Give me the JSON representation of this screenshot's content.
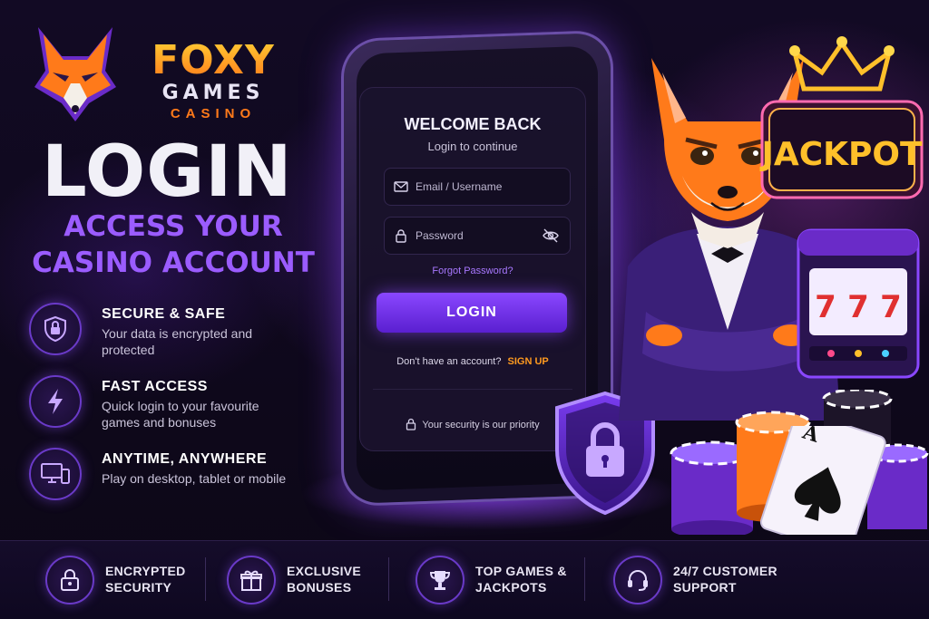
{
  "brand": {
    "name": "FOXY",
    "games": "GAMES",
    "casino": "CASINO"
  },
  "hero": {
    "title": "LOGIN",
    "subtitle_line1": "ACCESS YOUR",
    "subtitle_line2": "CASINO ACCOUNT"
  },
  "features": [
    {
      "icon": "shield-lock-icon",
      "title": "SECURE & SAFE",
      "desc": "Your data is encrypted and protected"
    },
    {
      "icon": "lightning-icon",
      "title": "FAST ACCESS",
      "desc": "Quick login to your favourite games and bonuses"
    },
    {
      "icon": "devices-icon",
      "title": "ANYTIME, ANYWHERE",
      "desc": "Play on desktop, tablet or mobile"
    }
  ],
  "login_form": {
    "heading": "WELCOME BACK",
    "subheading": "Login to continue",
    "email_placeholder": "Email / Username",
    "password_placeholder": "Password",
    "forgot_link": "Forgot Password?",
    "login_button": "LOGIN",
    "no_account_text": "Don't have an account?",
    "signup_link": "SIGN UP",
    "security_note": "Your security is our priority"
  },
  "art": {
    "jackpot_text": "JACKPOT",
    "slot_reels": [
      "7",
      "7",
      "7"
    ],
    "card_rank": "A"
  },
  "perks": [
    {
      "icon": "lock-icon",
      "line1": "ENCRYPTED",
      "line2": "SECURITY"
    },
    {
      "icon": "gift-icon",
      "line1": "EXCLUSIVE",
      "line2": "BONUSES"
    },
    {
      "icon": "trophy-icon",
      "line1": "TOP GAMES &",
      "line2": "JACKPOTS"
    },
    {
      "icon": "headset-icon",
      "line1": "24/7 CUSTOMER",
      "line2": "SUPPORT"
    }
  ],
  "colors": {
    "accent_purple": "#8a47ff",
    "accent_orange": "#ff7a1a",
    "background": "#0d0818"
  }
}
